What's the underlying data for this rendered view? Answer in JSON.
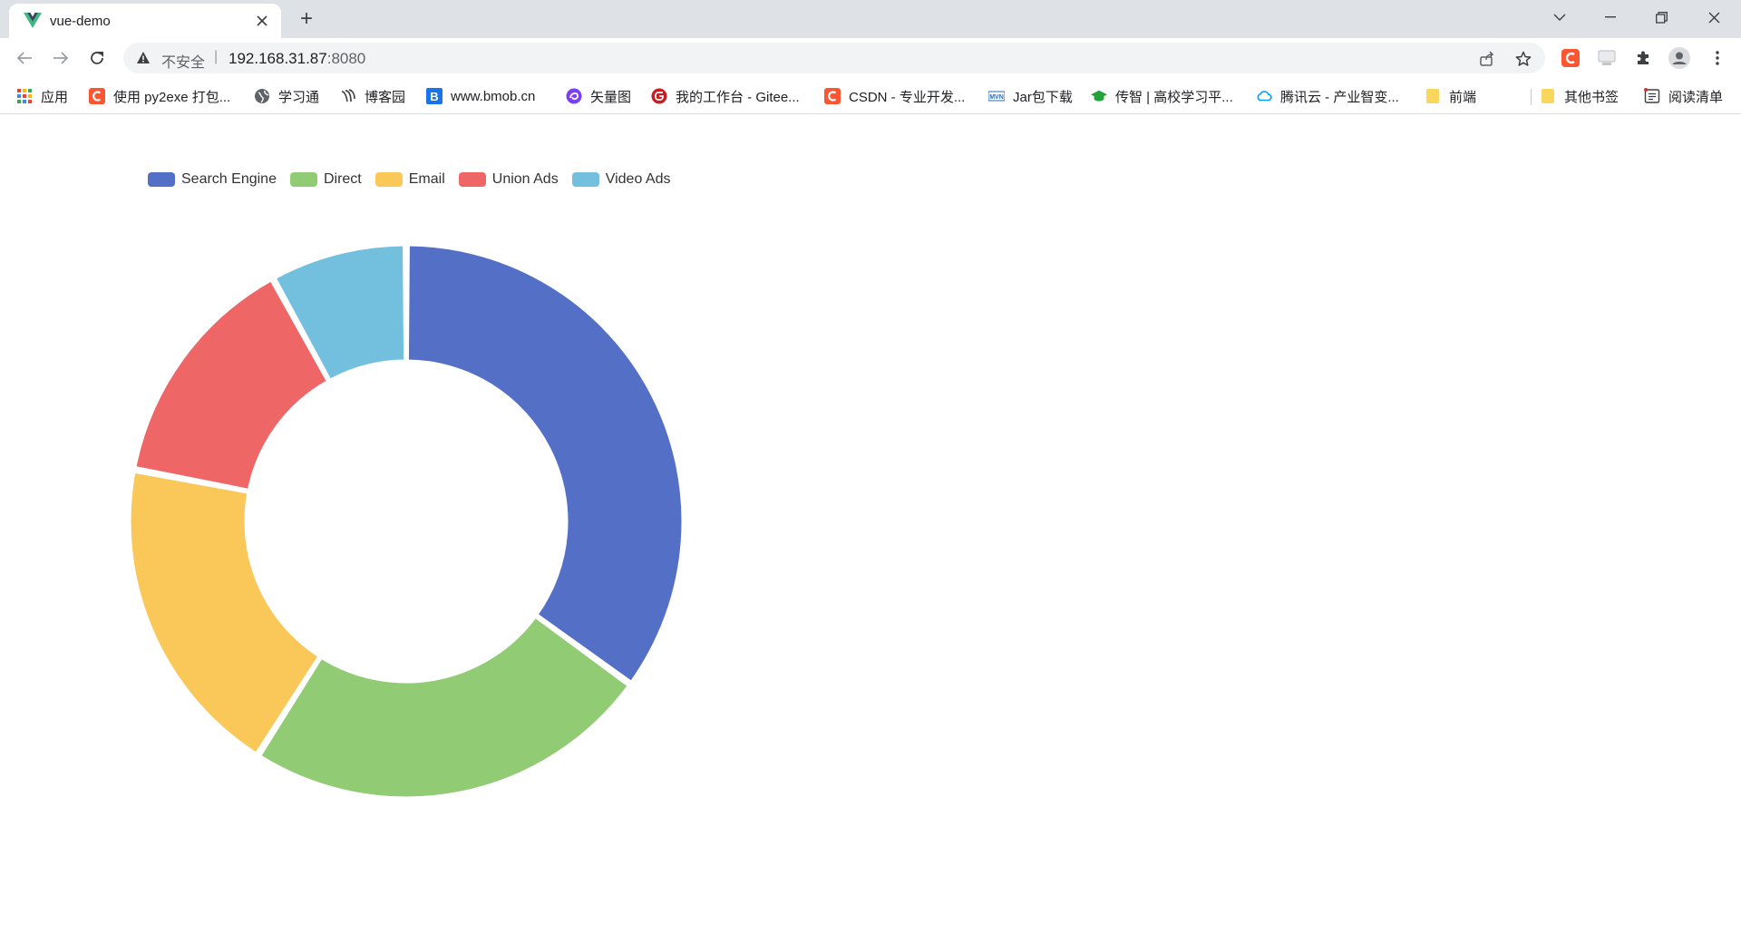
{
  "browser": {
    "tab": {
      "title": "vue-demo",
      "favicon": "vue-logo-icon",
      "favicon_color": "#41b883"
    },
    "new_tab_symbol": "+",
    "address": {
      "security_text": "不安全",
      "separator": "|",
      "host": "192.168.31.87",
      "port": ":8080"
    },
    "window_controls": [
      "tab-search-icon",
      "minimize-icon",
      "restore-icon",
      "close-icon"
    ],
    "toolbar_icons": [
      "share-icon",
      "star-icon",
      "csdn-extension-icon",
      "cast-icon",
      "extensions-icon",
      "profile-icon",
      "menu-icon"
    ]
  },
  "bookmarks": [
    {
      "label": "应用",
      "icon": "apps-grid-icon"
    },
    {
      "label": "使用 py2exe 打包...",
      "icon": "csdn-icon"
    },
    {
      "label": "学习通",
      "icon": "globe-icon"
    },
    {
      "label": "博客园",
      "icon": "cnblogs-icon"
    },
    {
      "label": "www.bmob.cn",
      "icon": "bmob-icon"
    },
    {
      "label": "矢量图",
      "icon": "iconfont-icon"
    },
    {
      "label": "我的工作台 - Gitee...",
      "icon": "gitee-icon"
    },
    {
      "label": "CSDN - 专业开发...",
      "icon": "csdn-icon"
    },
    {
      "label": "Jar包下载",
      "icon": "mvn-icon"
    },
    {
      "label": "传智 | 高校学习平...",
      "icon": "graduation-cap-icon"
    },
    {
      "label": "腾讯云 - 产业智变...",
      "icon": "tencent-cloud-icon"
    },
    {
      "label": "前端",
      "icon": "folder-icon"
    },
    {
      "label": "其他书签",
      "icon": "folder-icon"
    },
    {
      "label": "阅读清单",
      "icon": "reading-list-icon"
    }
  ],
  "colors": {
    "accent_csdn": "#fc5531",
    "folder": "#f9d65c"
  },
  "chart_data": {
    "type": "pie",
    "variant": "donut",
    "title": "",
    "legend_position": "top-left",
    "series": [
      {
        "name": "Search Engine",
        "value": 35,
        "color": "#5470c6"
      },
      {
        "name": "Direct",
        "value": 24,
        "color": "#91cc75"
      },
      {
        "name": "Email",
        "value": 19,
        "color": "#fac858"
      },
      {
        "name": "Union Ads",
        "value": 14,
        "color": "#ee6666"
      },
      {
        "name": "Video Ads",
        "value": 8,
        "color": "#73c0de"
      }
    ]
  }
}
